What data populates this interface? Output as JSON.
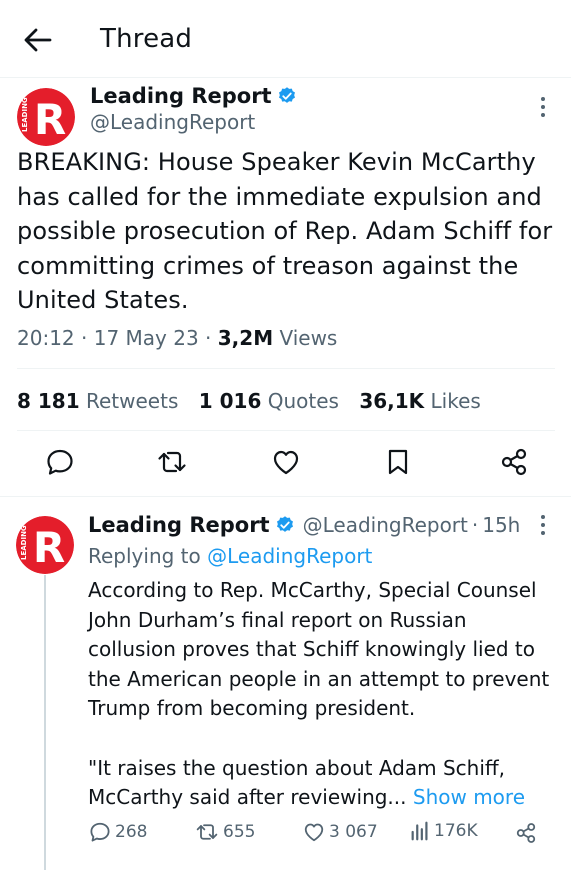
{
  "header": {
    "title": "Thread"
  },
  "main_tweet": {
    "author_name": "Leading Report",
    "handle": "@LeadingReport",
    "text": "BREAKING: House Speaker Kevin McCarthy has called for the immediate expulsion and possible prosecution of Rep. Adam Schiff for committing crimes of treason against the United States.",
    "time": "20:12",
    "date": "17 May 23",
    "views_count": "3,2M",
    "views_label": "Views",
    "retweets_count": "8 181",
    "retweets_label": "Retweets",
    "quotes_count": "1 016",
    "quotes_label": "Quotes",
    "likes_count": "36,1K",
    "likes_label": "Likes"
  },
  "reply_tweet": {
    "author_name": "Leading Report",
    "handle": "@LeadingReport",
    "age": "15h",
    "replying_prefix": "Replying to",
    "replying_handle": "@LeadingReport",
    "paragraph1": "According to Rep. McCarthy, Special Counsel John Durham’s final report on Russian collusion proves that Schiff knowingly lied to the American people in an attempt to prevent Trump from becoming president.",
    "paragraph2": "\"It raises the question about Adam Schiff, McCarthy said after reviewing...",
    "show_more": "Show more",
    "replies": "268",
    "retweets": "655",
    "likes": "3 067",
    "views": "176K"
  },
  "avatar_logo_text": "LEADING",
  "avatar_letter": "R",
  "colors": {
    "accent": "#1d9bf0",
    "brand_red": "#e41e2b",
    "text": "#0f1419",
    "secondary": "#536471",
    "divider": "#eff3f4"
  },
  "icons": {
    "back": "back-arrow-icon",
    "verified": "verified-badge-icon",
    "more": "more-vertical-icon",
    "reply": "reply-icon",
    "retweet": "retweet-icon",
    "like": "like-icon",
    "bookmark": "bookmark-icon",
    "share": "share-icon",
    "views": "views-icon"
  }
}
